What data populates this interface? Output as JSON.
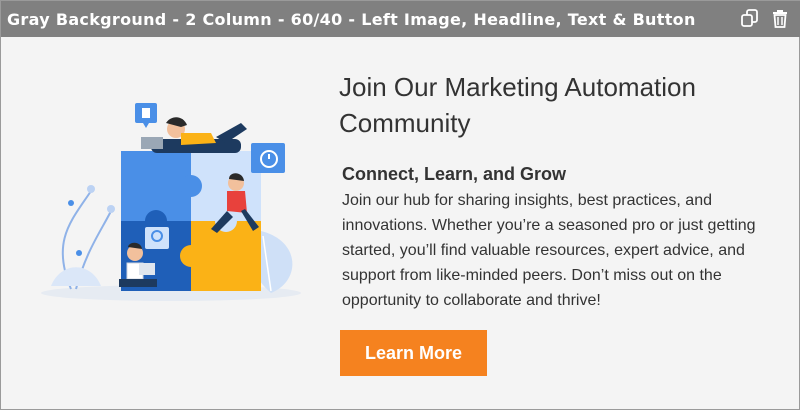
{
  "editor": {
    "title": "Gray Background - 2 Column - 60/40 - Left Image, Headline, Text & Button",
    "copy_icon": "copy-icon",
    "delete_icon": "trash-icon"
  },
  "section": {
    "image_alt": "Illustration of people collaborating around puzzle pieces",
    "headline": "Join Our Marketing Automation Community",
    "subheadline": "Connect, Learn, and Grow",
    "body": "Join our hub for sharing insights, best practices, and innovations. Whether you’re a seasoned pro or just getting started, you’ll find valuable resources, expert advice, and support from like-minded peers. Don’t miss out on the opportunity to collaborate and thrive!",
    "button_label": "Learn More"
  },
  "colors": {
    "titlebar": "#808080",
    "background": "#f4f4f4",
    "button": "#f5821f",
    "puzzle_blue": "#4a8fe7",
    "puzzle_light": "#cfe2fb",
    "puzzle_yellow": "#fbb216",
    "puzzle_navy": "#1f5fb8"
  }
}
